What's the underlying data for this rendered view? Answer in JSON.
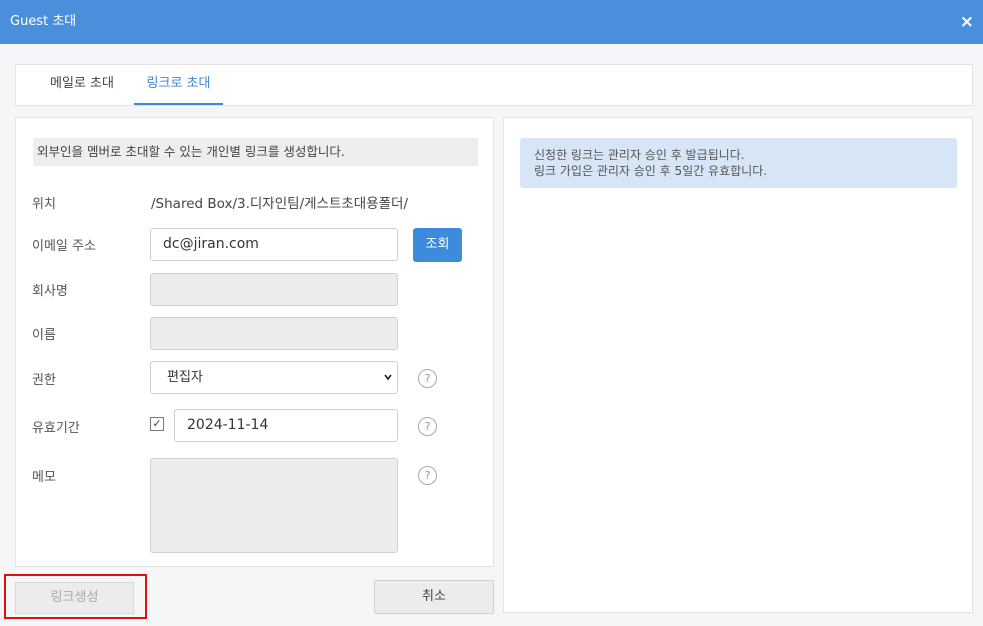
{
  "dialog": {
    "title": "Guest 초대",
    "close_icon": "×"
  },
  "tabs": [
    {
      "label": "메일로 초대",
      "active": false
    },
    {
      "label": "링크로 초대",
      "active": true
    }
  ],
  "form": {
    "notice": "외부인을 멤버로 초대할 수 있는 개인별 링크를 생성합니다.",
    "location_label": "위치",
    "location_value": "/Shared Box/3.디자인팀/게스트초대용폴더/",
    "email_label": "이메일 주소",
    "email_value": "dc@jiran.com",
    "search_button": "조회",
    "company_label": "회사명",
    "company_value": "",
    "name_label": "이름",
    "name_value": "",
    "permission_label": "권한",
    "permission_value": "편집자",
    "expiry_label": "유효기간",
    "expiry_checked": true,
    "expiry_check_mark": "✓",
    "expiry_value": "2024-11-14",
    "memo_label": "메모",
    "memo_value": "",
    "help_icon": "?"
  },
  "info": {
    "line1": "신청한 링크는 관리자 승인 후 발급됩니다.",
    "line2": "링크 가입은 관리자 승인 후 5일간 유효합니다."
  },
  "buttons": {
    "create": "링크생성",
    "cancel": "취소"
  },
  "colors": {
    "titlebar": "#4a8fdc",
    "accent": "#3d86d9",
    "highlight": "#e01010"
  }
}
